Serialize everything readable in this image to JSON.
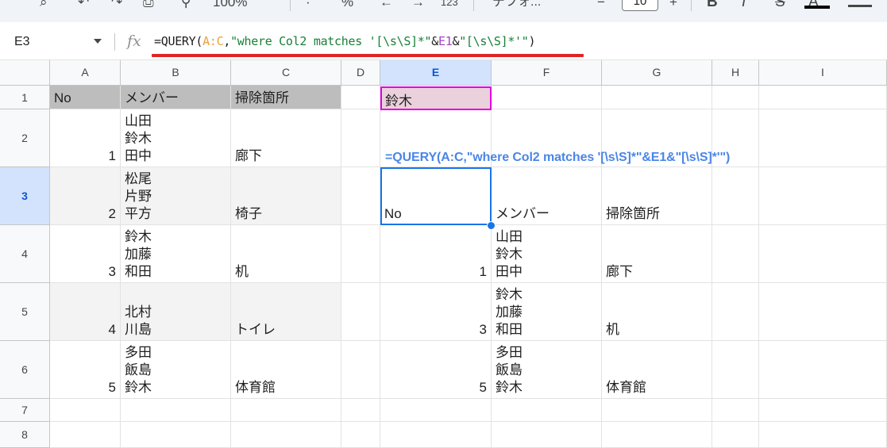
{
  "toolbar": {
    "zoom": "100%",
    "percent": "%",
    "number_format": "123",
    "font_name": "デフォ...",
    "font_size": "10",
    "plus": "+",
    "bold": "B",
    "italic": "I",
    "strike": "S",
    "text_color": "A"
  },
  "formula_bar": {
    "name_box": "E3",
    "fx_label": "fx",
    "formula": {
      "prefix": "=QUERY(",
      "range": "A:C",
      "comma": ",",
      "str1": "\"where Col2 matches '[\\s\\S]*\"",
      "amp1": "&",
      "ref": "E1",
      "amp2": "&",
      "str2": "\"[\\s\\S]*'\"",
      "suffix": ")"
    }
  },
  "columns": [
    "A",
    "B",
    "C",
    "D",
    "E",
    "F",
    "G",
    "H",
    "I"
  ],
  "rows": [
    "1",
    "2",
    "3",
    "4",
    "5",
    "6",
    "7",
    "8"
  ],
  "selected_cell": "E3",
  "source_table": {
    "header": {
      "no": "No",
      "member": "メンバー",
      "place": "掃除箇所"
    },
    "rows": [
      {
        "no": "1",
        "members": "山田\n鈴木\n田中",
        "place": "廊下"
      },
      {
        "no": "2",
        "members": "松尾\n片野\n平方",
        "place": "椅子"
      },
      {
        "no": "3",
        "members": "鈴木\n加藤\n和田",
        "place": "机"
      },
      {
        "no": "4",
        "members": "北村\n川島",
        "place": "トイレ"
      },
      {
        "no": "5",
        "members": "多田\n飯島\n鈴木",
        "place": "体育館"
      }
    ]
  },
  "e1_value": "鈴木",
  "annotation": "=QUERY(A:C,\"where Col2 matches '[\\s\\S]*\"&E1&\"[\\s\\S]*'\")",
  "result_table": {
    "header": {
      "no": "No",
      "member": "メンバー",
      "place": "掃除箇所"
    },
    "rows": [
      {
        "no": "1",
        "members": "山田\n鈴木\n田中",
        "place": "廊下"
      },
      {
        "no": "3",
        "members": "鈴木\n加藤\n和田",
        "place": "机"
      },
      {
        "no": "5",
        "members": "多田\n飯島\n鈴木",
        "place": "体育館"
      }
    ]
  },
  "colors": {
    "selection_blue": "#1a73e8",
    "highlight_pink": "#ead1dc",
    "magenta_border": "#e000e0",
    "annotation_blue": "#4a86e8",
    "red_underline": "#e02424",
    "header_gray": "#bdbdbd"
  }
}
